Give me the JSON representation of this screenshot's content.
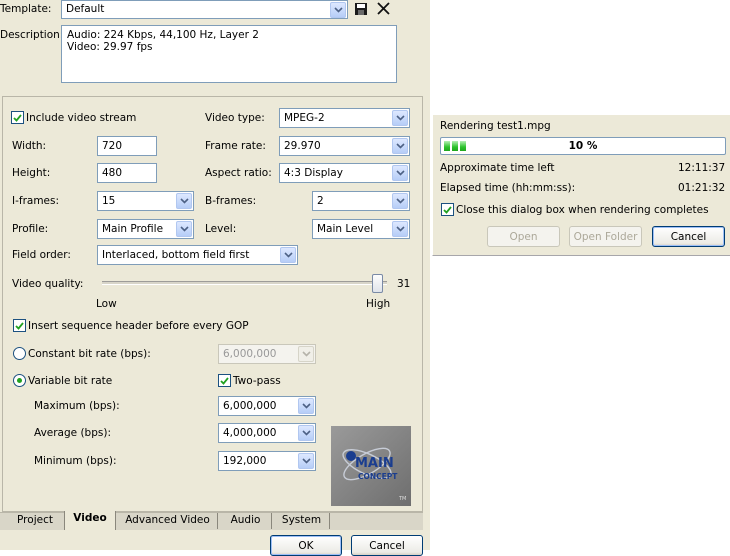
{
  "template": {
    "label": "Template:",
    "value": "Default"
  },
  "description": {
    "label": "Description:",
    "lines": [
      "Audio: 224 Kbps, 44,100 Hz, Layer 2",
      "Video: 29.97 fps"
    ]
  },
  "video": {
    "include_video_stream": {
      "label": "Include video stream",
      "checked": true
    },
    "video_type": {
      "label": "Video type:",
      "value": "MPEG-2"
    },
    "width": {
      "label": "Width:",
      "value": "720"
    },
    "frame_rate": {
      "label": "Frame rate:",
      "value": "29.970"
    },
    "height": {
      "label": "Height:",
      "value": "480"
    },
    "aspect_ratio": {
      "label": "Aspect ratio:",
      "value": "4:3 Display"
    },
    "i_frames": {
      "label": "I-frames:",
      "value": "15"
    },
    "b_frames": {
      "label": "B-frames:",
      "value": "2"
    },
    "profile": {
      "label": "Profile:",
      "value": "Main Profile"
    },
    "level": {
      "label": "Level:",
      "value": "Main Level"
    },
    "field_order": {
      "label": "Field order:",
      "value": "Interlaced, bottom field first"
    },
    "video_quality": {
      "label": "Video quality:",
      "value": "31",
      "low": "Low",
      "high": "High",
      "level": 0.97
    },
    "insert_sequence_header": {
      "label": "Insert sequence header before every GOP",
      "checked": true
    },
    "constant_bit_rate": {
      "label": "Constant bit rate (bps):",
      "value": "6,000,000",
      "selected": false
    },
    "variable_bit_rate": {
      "label": "Variable bit rate",
      "selected": true
    },
    "two_pass": {
      "label": "Two-pass",
      "checked": true
    },
    "maximum": {
      "label": "Maximum (bps):",
      "value": "6,000,000"
    },
    "average": {
      "label": "Average (bps):",
      "value": "4,000,000"
    },
    "minimum": {
      "label": "Minimum (bps):",
      "value": "192,000"
    },
    "logo": {
      "line1": "MAIN",
      "line2": "CONCEPT",
      "tm": "TM"
    }
  },
  "tabs": [
    {
      "label": "Project",
      "active": false
    },
    {
      "label": "Video",
      "active": true
    },
    {
      "label": "Advanced Video",
      "active": false
    },
    {
      "label": "Audio",
      "active": false
    },
    {
      "label": "System",
      "active": false
    }
  ],
  "buttons": {
    "ok": "OK",
    "cancel": "Cancel"
  },
  "render": {
    "title": "Rendering test1.mpg",
    "progress_text": "10 %",
    "progress": 0.1,
    "approx_label": "Approximate time left",
    "approx_value": "12:11:37",
    "elapsed_label": "Elapsed time (hh:mm:ss):",
    "elapsed_value": "01:21:32",
    "close_when_done": {
      "label": "Close this dialog box when rendering completes",
      "checked": true
    },
    "open": "Open",
    "open_folder": "Open Folder",
    "cancel": "Cancel"
  },
  "icons": {
    "save": "save-icon",
    "delete": "delete-icon",
    "dropdown": "chevron-down-icon",
    "check": "checkmark-icon"
  },
  "colors": {
    "dialog_bg": "#ece9d8",
    "border_blue": "#7f9db9",
    "progress_green": "#2bc22b",
    "logo_blue": "#1a3d8f"
  }
}
